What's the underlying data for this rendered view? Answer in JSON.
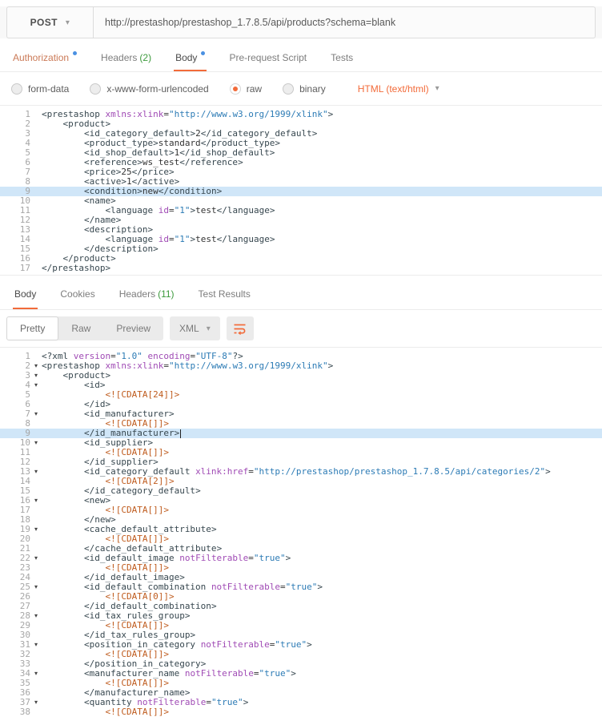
{
  "colors": {
    "accent_orange": "#f26b3a",
    "unsaved_dot_blue": "#4a90e2",
    "count_green": "#3d9a3d",
    "active_line_highlight": "#d0e6f8"
  },
  "request": {
    "method": "POST",
    "url": "http://prestashop/prestashop_1.7.8.5/api/products?schema=blank",
    "tabs": [
      {
        "label": "Authorization",
        "dot": true,
        "tint": "orange"
      },
      {
        "label": "Headers",
        "count": "(2)"
      },
      {
        "label": "Body",
        "dot": true,
        "active": true
      },
      {
        "label": "Pre-request Script"
      },
      {
        "label": "Tests"
      }
    ],
    "body_modes": [
      {
        "label": "form-data"
      },
      {
        "label": "x-www-form-urlencoded"
      },
      {
        "label": "raw",
        "selected": true
      },
      {
        "label": "binary"
      }
    ],
    "raw_type": "HTML (text/html)",
    "editor": {
      "highlight_line": 9,
      "lines": [
        "<prestashop xmlns:xlink=\"http://www.w3.org/1999/xlink\">",
        "    <product>",
        "        <id_category_default>2</id_category_default>",
        "        <product_type>standard</product_type>",
        "        <id_shop_default>1</id_shop_default>",
        "        <reference>ws_test</reference>",
        "        <price>25</price>",
        "        <active>1</active>",
        "        <condition>new</condition>",
        "        <name>",
        "            <language id=\"1\">test</language>",
        "        </name>",
        "        <description>",
        "            <language id=\"1\">test</language>",
        "        </description>",
        "    </product>",
        "</prestashop>"
      ]
    }
  },
  "response": {
    "tabs": [
      {
        "label": "Body",
        "active": true
      },
      {
        "label": "Cookies"
      },
      {
        "label": "Headers",
        "count": "(11)"
      },
      {
        "label": "Test Results"
      }
    ],
    "view_modes": [
      {
        "label": "Pretty",
        "selected": true
      },
      {
        "label": "Raw"
      },
      {
        "label": "Preview"
      }
    ],
    "format": "XML",
    "editor": {
      "highlight_line": 9,
      "cursor_line": 9,
      "fold_lines": [
        2,
        3,
        4,
        7,
        10,
        13,
        16,
        19,
        22,
        25,
        28,
        31,
        34,
        37
      ],
      "lines": [
        "<?xml version=\"1.0\" encoding=\"UTF-8\"?>",
        "<prestashop xmlns:xlink=\"http://www.w3.org/1999/xlink\">",
        "    <product>",
        "        <id>",
        "            <![CDATA[24]]>",
        "        </id>",
        "        <id_manufacturer>",
        "            <![CDATA[]]>",
        "        </id_manufacturer>",
        "        <id_supplier>",
        "            <![CDATA[]]>",
        "        </id_supplier>",
        "        <id_category_default xlink:href=\"http://prestashop/prestashop_1.7.8.5/api/categories/2\">",
        "            <![CDATA[2]]>",
        "        </id_category_default>",
        "        <new>",
        "            <![CDATA[]]>",
        "        </new>",
        "        <cache_default_attribute>",
        "            <![CDATA[]]>",
        "        </cache_default_attribute>",
        "        <id_default_image notFilterable=\"true\">",
        "            <![CDATA[]]>",
        "        </id_default_image>",
        "        <id_default_combination notFilterable=\"true\">",
        "            <![CDATA[0]]>",
        "        </id_default_combination>",
        "        <id_tax_rules_group>",
        "            <![CDATA[]]>",
        "        </id_tax_rules_group>",
        "        <position_in_category notFilterable=\"true\">",
        "            <![CDATA[]]>",
        "        </position_in_category>",
        "        <manufacturer_name notFilterable=\"true\">",
        "            <![CDATA[]]>",
        "        </manufacturer_name>",
        "        <quantity notFilterable=\"true\">",
        "            <![CDATA[]]>"
      ]
    }
  }
}
